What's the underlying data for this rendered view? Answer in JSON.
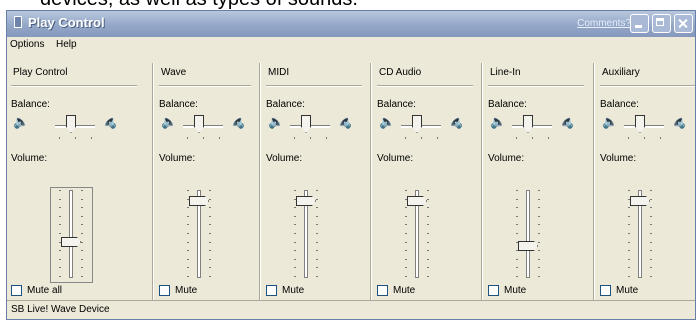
{
  "caption": "devices, as well as types of sounds.",
  "window": {
    "title": "Play Control",
    "comments_link": "Comments?"
  },
  "menu": {
    "options": "Options",
    "help": "Help"
  },
  "labels": {
    "balance": "Balance:",
    "volume": "Volume:"
  },
  "columns": [
    {
      "name": "Play Control",
      "mute": "Mute all",
      "balance_level": 0.5,
      "volume_level": 0.4,
      "muted": false
    },
    {
      "name": "Wave",
      "mute": "Mute",
      "balance_level": 0.5,
      "volume_level": 0.92,
      "muted": false
    },
    {
      "name": "MIDI",
      "mute": "Mute",
      "balance_level": 0.5,
      "volume_level": 0.92,
      "muted": false
    },
    {
      "name": "CD Audio",
      "mute": "Mute",
      "balance_level": 0.5,
      "volume_level": 0.92,
      "muted": false
    },
    {
      "name": "Line-In",
      "mute": "Mute",
      "balance_level": 0.5,
      "volume_level": 0.35,
      "muted": false
    },
    {
      "name": "Auxiliary",
      "mute": "Mute",
      "balance_level": 0.5,
      "volume_level": 0.92,
      "muted": false
    }
  ],
  "status": "SB Live! Wave Device"
}
